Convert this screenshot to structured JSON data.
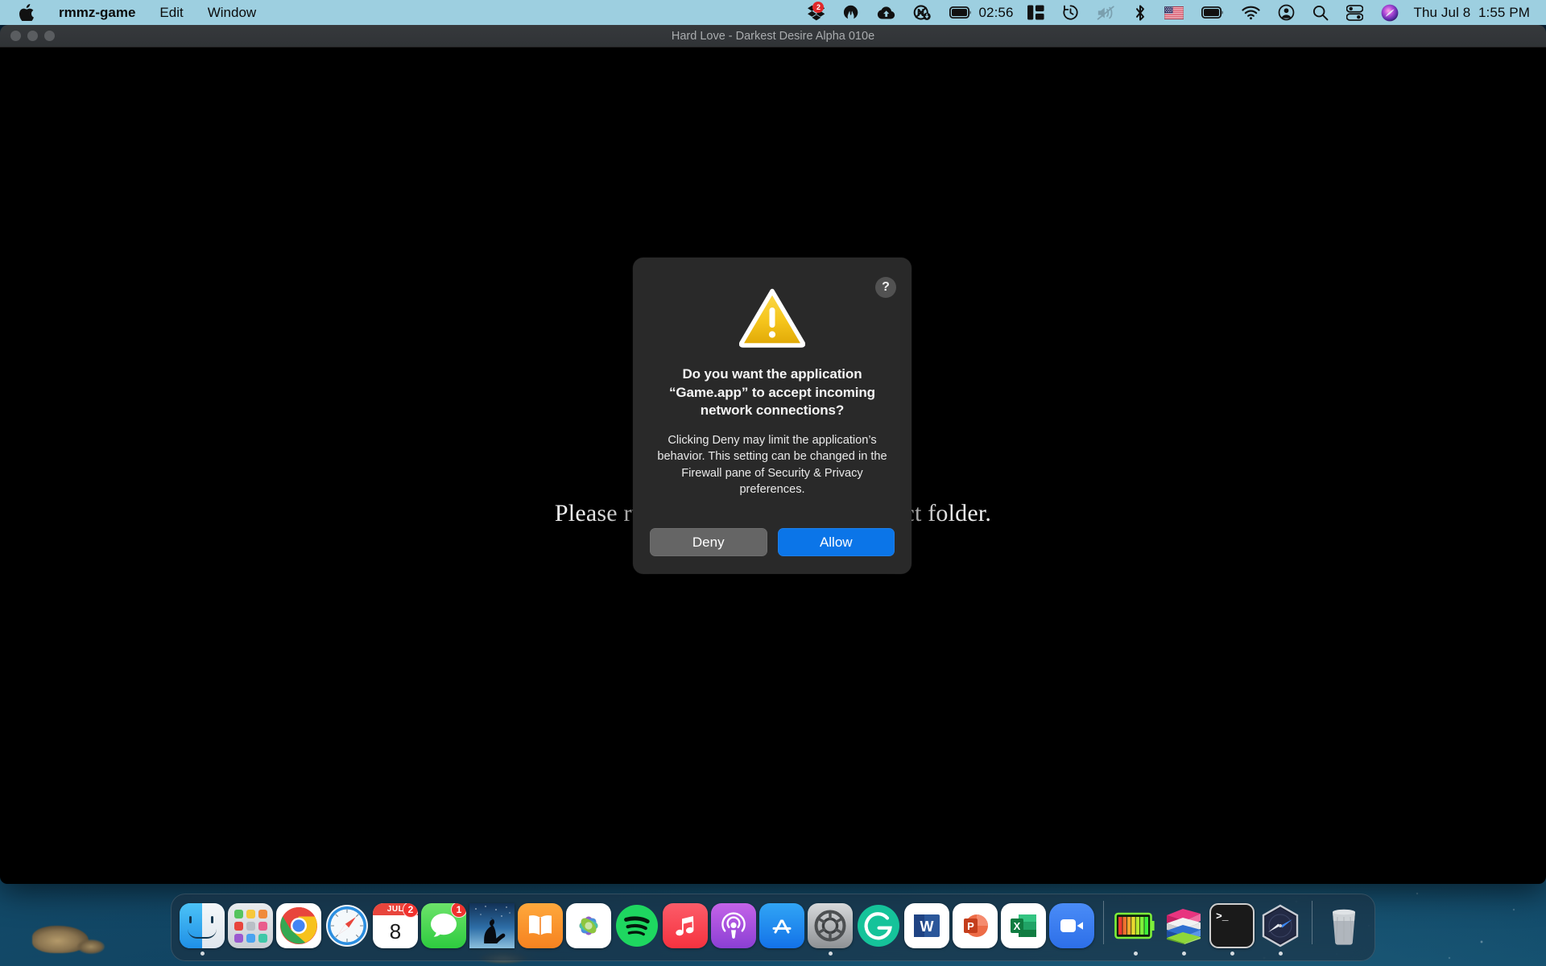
{
  "menubar": {
    "apple_icon": "apple-logo-icon",
    "items": [
      {
        "label": "rmmz-game",
        "bold": true
      },
      {
        "label": "Edit",
        "bold": false
      },
      {
        "label": "Window",
        "bold": false
      }
    ],
    "status_icons": [
      {
        "name": "dropbox-icon",
        "badge": "2"
      },
      {
        "name": "malwarebytes-icon",
        "badge": ""
      },
      {
        "name": "cloud-upload-icon",
        "badge": ""
      },
      {
        "name": "nosleep-icon",
        "badge": ""
      },
      {
        "name": "battery-icon",
        "badge": ""
      }
    ],
    "battery_time": "02:56",
    "status_icons_2": [
      {
        "name": "split-view-icon"
      },
      {
        "name": "time-machine-icon"
      },
      {
        "name": "volume-muted-icon"
      },
      {
        "name": "bluetooth-icon"
      },
      {
        "name": "us-flag-input-icon"
      },
      {
        "name": "battery-level-icon"
      },
      {
        "name": "wifi-icon"
      },
      {
        "name": "user-account-icon"
      },
      {
        "name": "spotlight-search-icon"
      },
      {
        "name": "control-center-icon"
      },
      {
        "name": "siri-icon"
      }
    ],
    "clock": "Thu Jul 8  1:55 PM"
  },
  "window": {
    "title": "Hard Love - Darkest Desire Alpha 010e",
    "traffic_lights": [
      "close",
      "minimize",
      "zoom"
    ],
    "message": "Please run this game from the correct folder."
  },
  "dialog": {
    "icon": "warning-triangle-icon",
    "help_label": "?",
    "title": "Do you want the application “Game.app” to accept incoming network connections?",
    "body": "Clicking Deny may limit the application’s behavior. This setting can be changed in the Firewall pane of Security & Privacy preferences.",
    "deny_label": "Deny",
    "allow_label": "Allow",
    "accent_color": "#0b75e8",
    "warning_color": "#f0bf20"
  },
  "dock": {
    "items": [
      {
        "name": "finder",
        "label": "Finder",
        "running": true,
        "badge": ""
      },
      {
        "name": "launchpad",
        "label": "Launchpad",
        "running": false,
        "badge": ""
      },
      {
        "name": "chrome",
        "label": "Google Chrome",
        "running": false,
        "badge": ""
      },
      {
        "name": "safari",
        "label": "Safari",
        "running": false,
        "badge": ""
      },
      {
        "name": "calendar",
        "label": "Calendar",
        "running": false,
        "badge": "2",
        "month": "JUL",
        "day": "8"
      },
      {
        "name": "messages",
        "label": "Messages",
        "running": false,
        "badge": "1"
      },
      {
        "name": "kindle",
        "label": "Kindle",
        "running": false,
        "badge": ""
      },
      {
        "name": "books",
        "label": "Books",
        "running": false,
        "badge": ""
      },
      {
        "name": "photos",
        "label": "Photos",
        "running": false,
        "badge": ""
      },
      {
        "name": "spotify",
        "label": "Spotify",
        "running": false,
        "badge": ""
      },
      {
        "name": "music",
        "label": "Music",
        "running": false,
        "badge": ""
      },
      {
        "name": "podcasts",
        "label": "Podcasts",
        "running": false,
        "badge": ""
      },
      {
        "name": "app-store",
        "label": "App Store",
        "running": false,
        "badge": ""
      },
      {
        "name": "system-preferences",
        "label": "System Preferences",
        "running": true,
        "badge": ""
      },
      {
        "name": "grammarly",
        "label": "Grammarly",
        "running": false,
        "badge": ""
      },
      {
        "name": "word",
        "label": "Microsoft Word",
        "running": false,
        "badge": ""
      },
      {
        "name": "powerpoint",
        "label": "Microsoft PowerPoint",
        "running": false,
        "badge": ""
      },
      {
        "name": "excel",
        "label": "Microsoft Excel",
        "running": false,
        "badge": ""
      },
      {
        "name": "zoom",
        "label": "Zoom",
        "running": false,
        "badge": ""
      }
    ],
    "items_right": [
      {
        "name": "battery-monitor",
        "label": "Battery Monitor",
        "running": true,
        "badge": ""
      },
      {
        "name": "winrar",
        "label": "WinRAR",
        "running": true,
        "badge": ""
      },
      {
        "name": "terminal",
        "label": "Terminal",
        "running": true,
        "badge": ""
      },
      {
        "name": "insomnia",
        "label": "Insomnia",
        "running": true,
        "badge": ""
      }
    ],
    "trash": {
      "name": "trash",
      "label": "Trash"
    }
  }
}
